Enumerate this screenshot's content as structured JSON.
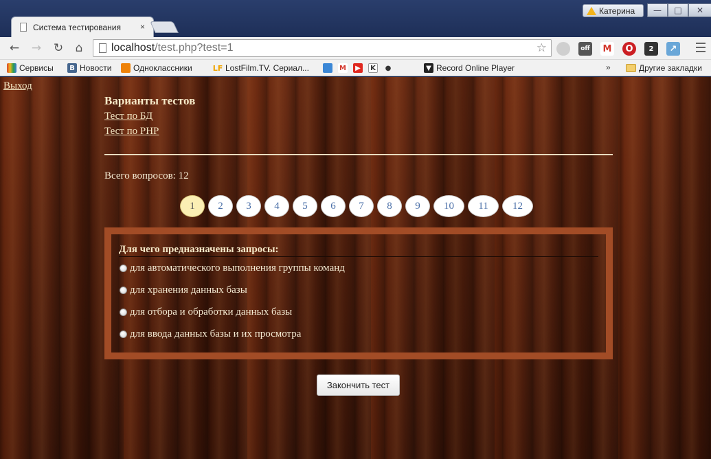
{
  "browser": {
    "user_badge": "Катерина",
    "tab_title": "Система тестирования",
    "tab_close": "×",
    "url_host": "localhost",
    "url_path": "/test.php?test=1",
    "bookmarks": [
      {
        "label": "Сервисы",
        "icon": "apps-icon",
        "color": "#d6452f"
      },
      {
        "label": "Новости",
        "icon": "vk-icon",
        "color": "#45668e",
        "glyph": "В"
      },
      {
        "label": "Одноклассники",
        "icon": "odnoklassniki-icon",
        "color": "#ee8208"
      },
      {
        "label": "LostFilm.TV. Сериал...",
        "icon": "lostfilm-icon",
        "color": "#f0a400",
        "glyph": "LF"
      },
      {
        "label": "Record Online Player",
        "icon": "record-icon",
        "color": "#222222"
      }
    ],
    "bookmarks_more": "»",
    "other_bookmarks": "Другие закладки",
    "win_min": "—",
    "win_max": "□",
    "win_close": "✕"
  },
  "page": {
    "logout": "Выход",
    "tests_title": "Варианты тестов",
    "test_links": [
      "Тест по БД",
      "Тест по PHP"
    ],
    "total_questions": "Всего вопросов: 12",
    "question_numbers": [
      "1",
      "2",
      "3",
      "4",
      "5",
      "6",
      "7",
      "8",
      "9",
      "10",
      "11",
      "12"
    ],
    "active_question": "1",
    "question": "Для чего предназначены запросы:",
    "options": [
      "для автоматического выполнения группы команд",
      "для хранения данных базы",
      "для отбора и обработки данных базы",
      "для ввода данных базы и их просмотра"
    ],
    "finish_button": "Закончить тест"
  },
  "colors": {
    "frame_border": "#a24c26",
    "active_question_bg": "#fbefb4",
    "link_text": "#f3e7c4"
  }
}
